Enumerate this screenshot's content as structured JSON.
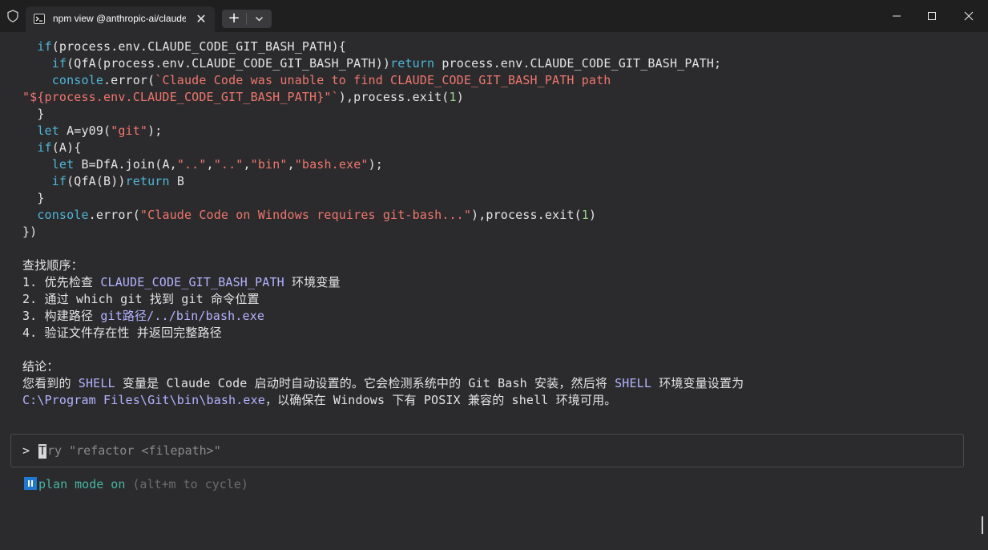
{
  "tab": {
    "title": "npm view @anthropic-ai/claude",
    "close": "✕"
  },
  "newtab": {
    "plus": "+"
  },
  "code": {
    "l1": {
      "a": "  ",
      "kw": "if",
      "b": "(process.env.CLAUDE_CODE_GIT_BASH_PATH){"
    },
    "l2": {
      "a": "    ",
      "kw1": "if",
      "b": "(QfA(process.env.CLAUDE_CODE_GIT_BASH_PATH))",
      "kw2": "return",
      "c": " process.env.CLAUDE_CODE_GIT_BASH_PATH;"
    },
    "l3": {
      "a": "    ",
      "kw": "console",
      "b": ".error(",
      "s": "`Claude Code was unable to find CLAUDE_CODE_GIT_BASH_PATH path"
    },
    "l4": {
      "s": "\"${process.env.CLAUDE_CODE_GIT_BASH_PATH}\"`",
      "b": "),process.exit(",
      "n": "1",
      "c": ")"
    },
    "l5": {
      "a": "  }"
    },
    "l6": {
      "a": "  ",
      "kw": "let",
      "b": " A=y09(",
      "s": "\"git\"",
      "c": ");"
    },
    "l7": {
      "a": "  ",
      "kw": "if",
      "b": "(A){"
    },
    "l8": {
      "a": "    ",
      "kw": "let",
      "b": " B=DfA.join(A,",
      "s1": "\"..\"",
      "c1": ",",
      "s2": "\"..\"",
      "c2": ",",
      "s3": "\"bin\"",
      "c3": ",",
      "s4": "\"bash.exe\"",
      "c4": ");"
    },
    "l9": {
      "a": "    ",
      "kw1": "if",
      "b": "(QfA(B))",
      "kw2": "return",
      "c": " B"
    },
    "l10": {
      "a": "  }"
    },
    "l11": {
      "a": "  ",
      "kw": "console",
      "b": ".error(",
      "s": "\"Claude Code on Windows requires git-bash...\"",
      "c": "),process.exit(",
      "n": "1",
      "d": ")"
    },
    "l12": {
      "a": "})"
    }
  },
  "explain": {
    "heading": "查找顺序：",
    "s1": {
      "a": "1. 优先检查 ",
      "h": "CLAUDE_CODE_GIT_BASH_PATH",
      "b": " 环境变量"
    },
    "s2": {
      "a": "2. 通过 which git 找到 git 命令位置"
    },
    "s3": {
      "a": "3. 构建路径 ",
      "h": "git路径/../bin/bash.exe"
    },
    "s4": {
      "a": "4. 验证文件存在性 并返回完整路径"
    },
    "conclusion": "结论：",
    "c1": {
      "a": "您看到的 ",
      "h1": "SHELL",
      "b": " 变量是 Claude Code 启动时自动设置的。它会检测系统中的 Git Bash 安装，然后将 ",
      "h2": "SHELL",
      "c": " 环境变量设置为"
    },
    "c2": {
      "h": "C:\\Program Files\\Git\\bin\\bash.exe",
      "a": "，以确保在 Windows 下有 POSIX 兼容的 shell 环境可用。"
    }
  },
  "input": {
    "prompt": ">",
    "cursor_char": "T",
    "placeholder": "ry \"refactor <filepath>\""
  },
  "mode": {
    "label": "plan mode on",
    "hint": " (alt+m to cycle)"
  },
  "colors": {
    "keyword": "#4fb5d6",
    "string": "#f0766d",
    "number": "#9ad58a",
    "highlight": "#b4b3ff",
    "mode": "#45b6a0"
  },
  "icons": {
    "shield": "shield-icon",
    "terminal": "terminal-icon",
    "pause": "pause-icon"
  }
}
